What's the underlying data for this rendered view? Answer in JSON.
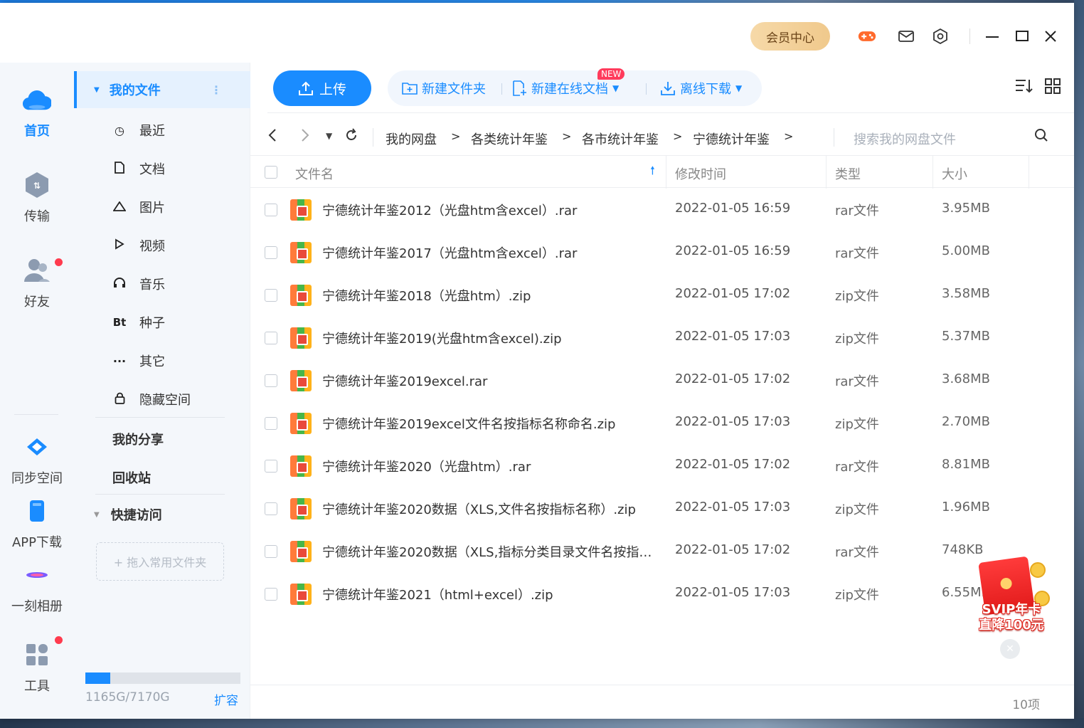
{
  "titlebar": {
    "vip_label": "会员中心",
    "icons": [
      "game-icon",
      "mail-icon",
      "settings-icon",
      "minimize-icon",
      "maximize-icon",
      "close-icon"
    ]
  },
  "rail": {
    "items": [
      {
        "label": "首页",
        "icon": "cloud-icon"
      },
      {
        "label": "传输",
        "icon": "transfer-icon"
      },
      {
        "label": "好友",
        "icon": "friends-icon"
      },
      {
        "label": "同步空间",
        "icon": "sync-icon"
      },
      {
        "label": "APP下载",
        "icon": "phone-icon"
      },
      {
        "label": "一刻相册",
        "icon": "album-icon"
      },
      {
        "label": "工具",
        "icon": "tools-icon"
      }
    ]
  },
  "sidebar": {
    "my_files": "我的文件",
    "items": [
      {
        "label": "最近",
        "icon": "clock-icon"
      },
      {
        "label": "文档",
        "icon": "doc-icon"
      },
      {
        "label": "图片",
        "icon": "image-icon"
      },
      {
        "label": "视频",
        "icon": "play-icon"
      },
      {
        "label": "音乐",
        "icon": "headphone-icon"
      },
      {
        "label": "种子",
        "icon": "bt-icon"
      },
      {
        "label": "其它",
        "icon": "more-icon"
      },
      {
        "label": "隐藏空间",
        "icon": "lock-icon"
      }
    ],
    "my_share": "我的分享",
    "recycle": "回收站",
    "quick_access": "快捷访问",
    "drop_hint": "+ 拖入常用文件夹",
    "storage_text": "1165G/7170G",
    "storage_used_fraction": 0.1625,
    "expand_label": "扩容"
  },
  "toolbar": {
    "upload": "上传",
    "new_folder": "新建文件夹",
    "new_online_doc": "新建在线文档",
    "new_badge": "NEW",
    "offline_download": "离线下载"
  },
  "path": {
    "crumbs": [
      "我的网盘",
      "各类统计年鉴",
      "各市统计年鉴",
      "宁德统计年鉴"
    ],
    "search_placeholder": "搜索我的网盘文件"
  },
  "table": {
    "headers": {
      "name": "文件名",
      "modified": "修改时间",
      "type": "类型",
      "size": "大小"
    },
    "rows": [
      {
        "name": "宁德统计年鉴2012（光盘htm含excel）.rar",
        "date": "2022-01-05 16:59",
        "type": "rar文件",
        "size": "3.95MB"
      },
      {
        "name": "宁德统计年鉴2017（光盘htm含excel）.rar",
        "date": "2022-01-05 16:59",
        "type": "rar文件",
        "size": "5.00MB"
      },
      {
        "name": "宁德统计年鉴2018（光盘htm）.zip",
        "date": "2022-01-05 17:02",
        "type": "zip文件",
        "size": "3.58MB"
      },
      {
        "name": "宁德统计年鉴2019(光盘htm含excel).zip",
        "date": "2022-01-05 17:03",
        "type": "zip文件",
        "size": "5.37MB"
      },
      {
        "name": "宁德统计年鉴2019excel.rar",
        "date": "2022-01-05 17:02",
        "type": "rar文件",
        "size": "3.68MB"
      },
      {
        "name": "宁德统计年鉴2019excel文件名按指标名称命名.zip",
        "date": "2022-01-05 17:03",
        "type": "zip文件",
        "size": "2.70MB"
      },
      {
        "name": "宁德统计年鉴2020（光盘htm）.rar",
        "date": "2022-01-05 17:02",
        "type": "rar文件",
        "size": "8.81MB"
      },
      {
        "name": "宁德统计年鉴2020数据（XLS,文件名按指标名称）.zip",
        "date": "2022-01-05 17:03",
        "type": "zip文件",
        "size": "1.96MB"
      },
      {
        "name": "宁德统计年鉴2020数据（XLS,指标分类目录文件名按指标...",
        "date": "2022-01-05 17:02",
        "type": "rar文件",
        "size": "748KB"
      },
      {
        "name": "宁德统计年鉴2021（html+excel）.zip",
        "date": "2022-01-05 17:03",
        "type": "zip文件",
        "size": "6.55MB"
      }
    ],
    "count": "10项"
  },
  "promo": {
    "line1": "SVIP年卡",
    "line2": "直降100元"
  },
  "colors": {
    "accent": "#1a8cff",
    "vip_bg": "#f6d9a8",
    "badge": "#ff3b5c"
  }
}
